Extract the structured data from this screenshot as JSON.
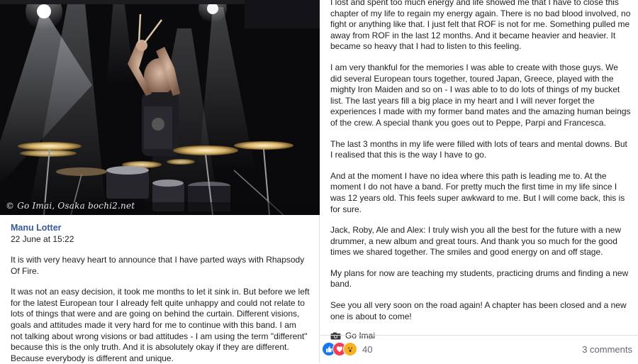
{
  "photo": {
    "watermark": "© Go Imai, Osaka bochi2.net",
    "icon": "concert-photo-drummer"
  },
  "post": {
    "author": "Manu Lotter",
    "date": "22 June at 15:22",
    "left_paragraphs": [
      "It is with very heavy heart to announce that I have parted ways with Rhapsody Of Fire.",
      "It was not an easy decision, it took me months to let it sink in. But before we left for the latest European tour I already felt quite unhappy and could not relate to lots of things that were and are going on behind the curtain. Different visions, goals and attitudes made it very hard for me to continue with this band. I am not talking about wrong visions or bad attitudes - I am using the term \"different\" because this is the only truth. And it is absolutely okay if they are different. Because everybody is different and unique."
    ],
    "right_paragraphs": [
      "I lost and spent too much energy and life showed me that I have to close this chapter of my life to regain my energy again. There is no bad blood involved, no fight or anything like that. I just felt that ROF is not for me. Something pulled me away from ROF in the last 12 months. And it became heavier and heavier. It became so heavy that I had to listen to this feeling.",
      "I am very thankful for the memories I was able to create with those guys. We did several European tours together, toured Japan, Greece, played with the mighty Iron Maiden and so on - I was able to to do lots of things of my bucket list. The last years fill a big place in my heart and I will never forget the experiences I made with my former band mates and the amazing human beings of the crew. A special thank you goes out to Peppe, Parpi and Francesca.",
      "The last 3 months in my life were filled with lots of tears and mental downs. But I realised that this is the way I have to go.",
      "And at the moment I have no idea where this path is leading me to. At the moment I do not have a band. For pretty much the first time in my life since I was 12 years old. This feels super awkward to me. But I will come back, this is for sure.",
      "Jack, Roby, Ale and Alex: I truly wish you all the best for the future with a new drummer, a new album and great tours. And thank you so much for the good times we shared together. The smiles and good energy on and off stage.",
      "My plans for now are teaching my students, practicing drums and finding a new band.",
      "See you all very soon on the road again! A chapter has been closed and a new one is about to come!"
    ],
    "photo_credit": "Go Imai",
    "photo_credit_icon": "camera-icon"
  },
  "footer": {
    "reaction_icons": [
      "like-icon",
      "love-icon",
      "wow-icon"
    ],
    "reaction_count": "40",
    "comments_label": "3 comments"
  },
  "colors": {
    "author_link": "#385898",
    "like": "#1877f2",
    "love": "#f33e58",
    "wow": "#f7b125"
  }
}
